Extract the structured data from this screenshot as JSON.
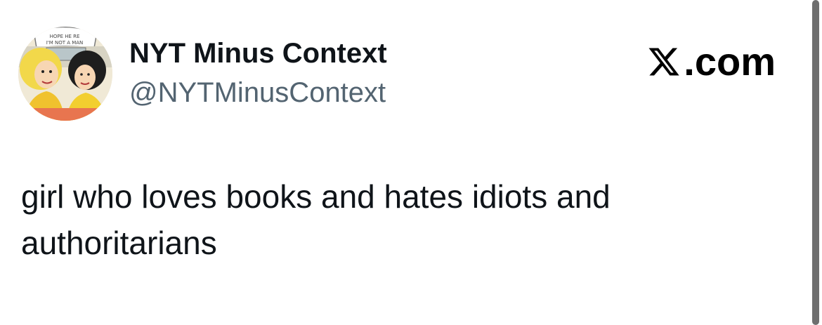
{
  "tweet": {
    "author": {
      "display_name": "NYT Minus Context",
      "handle": "@NYTMinusContext",
      "avatar_speech_line1": "HOPE HE RE",
      "avatar_speech_line2": "I'M NOT A MAN"
    },
    "brand": {
      "icon": "x-logo-icon",
      "suffix": ".com"
    },
    "text": "girl who loves books and hates idiots and authoritarians"
  },
  "colors": {
    "text_primary": "#0f1419",
    "text_secondary": "#536471",
    "background": "#ffffff",
    "scrollbar": "#6e6e6e"
  }
}
